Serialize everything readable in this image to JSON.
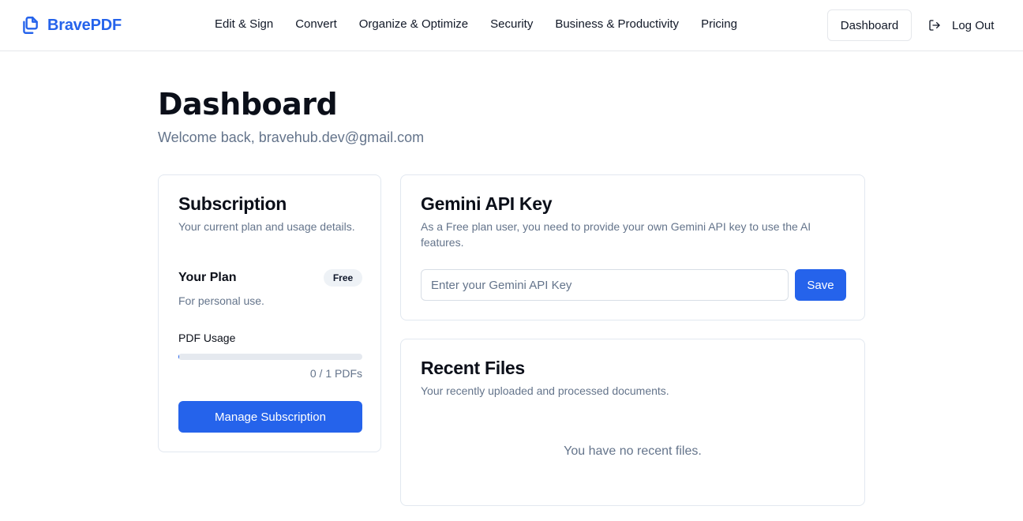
{
  "header": {
    "brand": "BravePDF",
    "nav": [
      "Edit & Sign",
      "Convert",
      "Organize & Optimize",
      "Security",
      "Business & Productivity",
      "Pricing"
    ],
    "dashboard_label": "Dashboard",
    "logout_label": "Log Out"
  },
  "page": {
    "title": "Dashboard",
    "welcome": "Welcome back, bravehub.dev@gmail.com"
  },
  "subscription": {
    "title": "Subscription",
    "description": "Your current plan and usage details.",
    "plan_label": "Your Plan",
    "plan_badge": "Free",
    "plan_description": "For personal use.",
    "usage_label": "PDF Usage",
    "usage_used": 0,
    "usage_limit": 1,
    "usage_text": "0 / 1 PDFs",
    "manage_label": "Manage Subscription"
  },
  "api_key": {
    "title": "Gemini API Key",
    "description": "As a Free plan user, you need to provide your own Gemini API key to use the AI features.",
    "placeholder": "Enter your Gemini API Key",
    "value": "",
    "save_label": "Save"
  },
  "recent_files": {
    "title": "Recent Files",
    "description": "Your recently uploaded and processed documents.",
    "empty_message": "You have no recent files."
  },
  "colors": {
    "accent": "#2563eb",
    "muted_text": "#64748b",
    "border": "#e2e8f0"
  },
  "icons": {
    "brand": "documents-icon",
    "logout": "log-out-icon"
  }
}
